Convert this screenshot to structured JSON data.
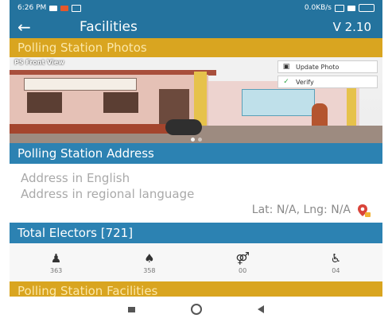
{
  "status_bar": {
    "time": "6:26 PM",
    "network_speed": "0.0KB/s"
  },
  "app_bar": {
    "title": "Facilities",
    "version": "V 2.10"
  },
  "photos_section": {
    "header": "Polling Station Photos",
    "photo_caption": "PS Front View",
    "update_photo_label": "Update Photo",
    "verify_label": "Verify"
  },
  "address_section": {
    "header": "Polling Station Address",
    "address_english": "Address in English",
    "address_regional": "Address in regional language",
    "lat_lng": "Lat: N/A, Lng: N/A"
  },
  "electors_section": {
    "header": "Total Electors [721]",
    "items": [
      {
        "icon": "male-icon",
        "count": "363"
      },
      {
        "icon": "female-icon",
        "count": "358"
      },
      {
        "icon": "third-gender-icon",
        "count": "00"
      },
      {
        "icon": "wheelchair-icon",
        "count": "04"
      }
    ]
  },
  "facilities_section": {
    "header": "Polling Station Facilities"
  },
  "colors": {
    "primary": "#24739e",
    "section_blue": "#2c82b2",
    "section_yellow": "#d9a520"
  }
}
